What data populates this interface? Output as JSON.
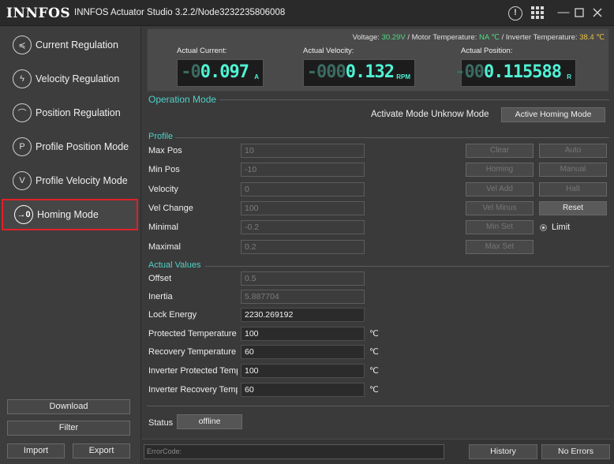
{
  "window": {
    "logo_text": "INNFOS",
    "title": "INNFOS Actuator Studio 3.2.2/Node3232235806008",
    "icons": [
      "info-icon",
      "grid-icon",
      "minimize-icon",
      "maximize-icon",
      "close-icon"
    ]
  },
  "sidebar": {
    "items": [
      {
        "label": "Current Regulation",
        "icon": "current-icon",
        "glyph": "≼"
      },
      {
        "label": "Velocity Regulation",
        "icon": "velocity-icon",
        "glyph": "ϟ"
      },
      {
        "label": "Position Regulation",
        "icon": "position-icon",
        "glyph": "⌒"
      },
      {
        "label": "Profile Position Mode",
        "icon": "profile-position-icon",
        "glyph": "P"
      },
      {
        "label": "Profile Velocity Mode",
        "icon": "profile-velocity-icon",
        "glyph": "V"
      },
      {
        "label": "Homing Mode",
        "icon": "homing-icon",
        "glyph": "→0",
        "active": true
      }
    ],
    "buttons": {
      "download": "Download",
      "filter": "Filter",
      "import": "Import",
      "export": "Export"
    }
  },
  "header": {
    "voltage_label": "Voltage:",
    "voltage_value": "30.29V",
    "motor_temp_label": "/ Motor Temperature:",
    "motor_temp_value": "NA ℃",
    "inverter_temp_label": "/ Inverter Temperature:",
    "inverter_temp_value": "38.4 ℃",
    "current": {
      "label": "Actual Current:",
      "dim": "-0",
      "lit": "0.097",
      "unit": "A"
    },
    "velocity": {
      "label": "Actual Velocity:",
      "dim": "-000",
      "lit": "0.132",
      "unit": "RPM"
    },
    "position": {
      "label": "Actual Position:",
      "dim": "-00",
      "lit": "0.115588",
      "unit": "R"
    },
    "colors": {
      "meter_lit": "#4ff3d4",
      "meter_dim": "#3a6b61",
      "voltage_green": "#4ade80",
      "inverter_yellow": "#e8c046"
    }
  },
  "operation": {
    "title": "Operation Mode",
    "activate_text": "Activate Mode Unknow Mode",
    "activate_button": "Active Homing Mode"
  },
  "profile": {
    "title": "Profile",
    "rows": [
      {
        "label": "Max Pos",
        "value": "10"
      },
      {
        "label": "Min Pos",
        "value": "-10"
      },
      {
        "label": "Velocity",
        "value": "0"
      },
      {
        "label": "Vel Change",
        "value": "100"
      },
      {
        "label": "Minimal",
        "value": "-0.2"
      },
      {
        "label": "Maximal",
        "value": "0.2"
      }
    ],
    "buttons": {
      "clear": "Clear",
      "auto": "Auto",
      "homing": "Homing",
      "manual": "Manual",
      "vel_add": "Vel Add",
      "halt": "Halt",
      "vel_minus": "Vel Minus",
      "reset": "Reset",
      "min_set": "Min Set",
      "max_set": "Max Set"
    },
    "limit_label": "Limit"
  },
  "actual_values": {
    "title": "Actual Values",
    "rows": [
      {
        "label": "Offset",
        "value": "0.5",
        "unit": ""
      },
      {
        "label": "Inertia",
        "value": "5.887704",
        "unit": ""
      },
      {
        "label": "Lock Energy",
        "value": "2230.269192",
        "unit": ""
      },
      {
        "label": "Protected Temperature",
        "value": "100",
        "unit": "℃"
      },
      {
        "label": "Recovery Temperature",
        "value": "60",
        "unit": "℃"
      },
      {
        "label": "Inverter Protected Temperature",
        "value": "100",
        "unit": "℃"
      },
      {
        "label": "Inverter Recovery Temperature",
        "value": "60",
        "unit": "℃"
      }
    ]
  },
  "status": {
    "label": "Status",
    "button": "offline"
  },
  "bottom": {
    "error_placeholder": "ErrorCode:",
    "history": "History",
    "no_errors": "No Errors"
  }
}
